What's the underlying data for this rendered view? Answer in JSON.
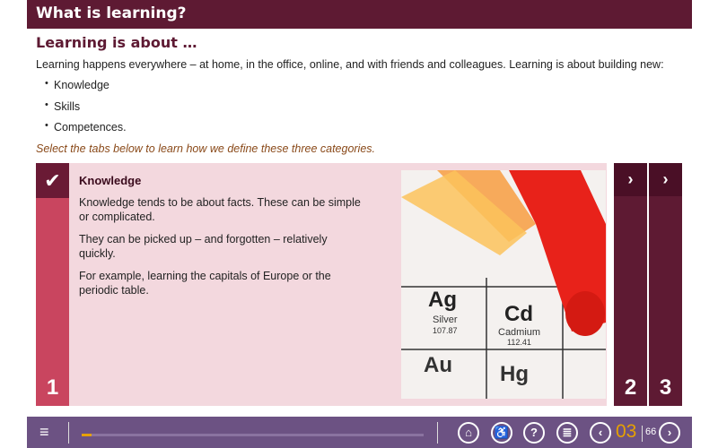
{
  "header": {
    "title": "What is learning?"
  },
  "section": {
    "title": "Learning is about …",
    "intro": "Learning happens everywhere – at home, in the office, online, and with friends and colleagues. Learning is about building new:",
    "bullets": [
      "Knowledge",
      "Skills",
      "Competences."
    ],
    "instruction": "Select the tabs below to learn how we define these three categories."
  },
  "tabs": [
    {
      "number": "1",
      "icon": "check-icon",
      "title": "Knowledge",
      "paragraphs": [
        "Knowledge tends to be about facts. These can be simple or complicated.",
        "They can be picked up – and forgotten – relatively quickly.",
        "For example, learning the capitals of Europe or the periodic table."
      ]
    },
    {
      "number": "2",
      "icon": "chevron-right-icon"
    },
    {
      "number": "3",
      "icon": "chevron-right-icon"
    }
  ],
  "photo": {
    "cells": [
      {
        "symbol": "Ag",
        "name": "Silver",
        "mass": "107.87"
      },
      {
        "symbol": "Cd",
        "name": "Cadmium",
        "mass": "112.41"
      },
      {
        "symbol": "Au"
      },
      {
        "symbol": "Hg"
      }
    ]
  },
  "footer": {
    "current_page": "03",
    "total_pages": "66",
    "progress_percent": 3,
    "colors": {
      "bar": "#6c5283",
      "accent": "#e6a100"
    }
  }
}
